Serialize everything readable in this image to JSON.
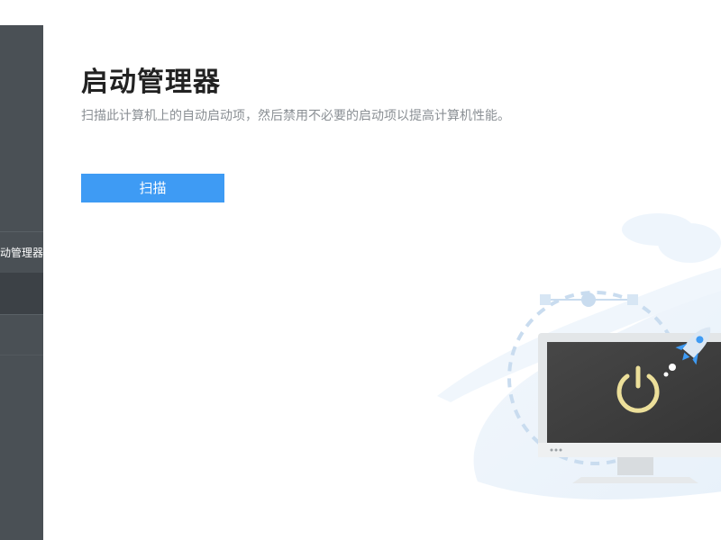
{
  "sidebar": {
    "items": [
      {
        "label": "启动管理器"
      }
    ]
  },
  "main": {
    "title": "启动管理器",
    "subtitle": "扫描此计算机上的自动启动项，然后禁用不必要的启动项以提高计算机性能。",
    "scan_button_label": "扫描"
  },
  "icons": {
    "power": "power-icon",
    "rocket": "rocket-icon",
    "monitor": "monitor-icon"
  },
  "colors": {
    "accent": "#3e9bf4",
    "sidebar": "#4a5055",
    "power_symbol": "#ecdf9a",
    "screen": "#3f3f3f"
  }
}
